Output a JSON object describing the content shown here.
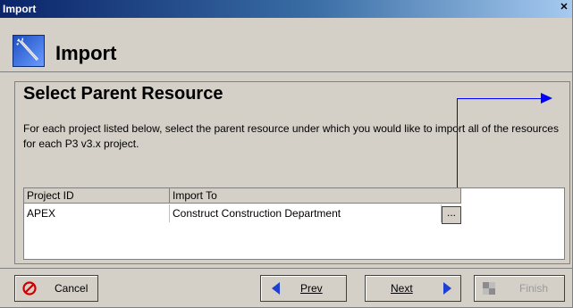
{
  "window": {
    "title": "Import",
    "close_glyph": "✕"
  },
  "header": {
    "title": "Import",
    "icon": "import-wand-icon"
  },
  "step": {
    "title": "Select Parent Resource",
    "description": "For each project listed below, select the parent resource under which you would like to import all of the resources for each P3 v3.x project."
  },
  "table": {
    "columns": [
      "Project ID",
      "Import To"
    ],
    "rows": [
      {
        "project_id": "APEX",
        "import_to": "Construct  Construction Department",
        "browse_label": "..."
      }
    ]
  },
  "buttons": {
    "cancel": "Cancel",
    "prev": "Prev",
    "next": "Next",
    "finish": "Finish"
  },
  "colors": {
    "accent_blue": "#0000ff",
    "title_gradient_start": "#0a246a",
    "cancel_red": "#cc0000"
  }
}
